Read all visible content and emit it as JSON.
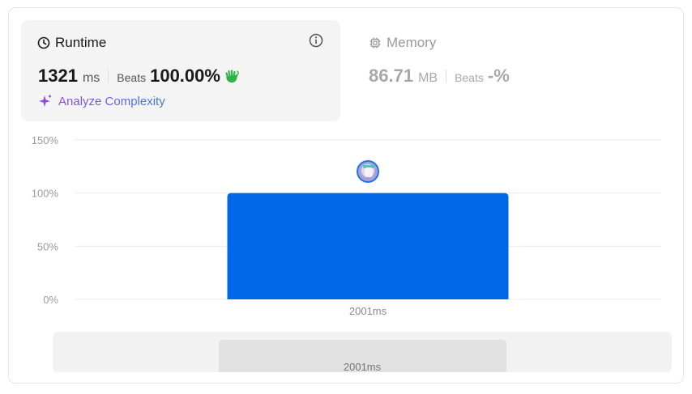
{
  "runtime": {
    "title": "Runtime",
    "value": "1321",
    "unit": "ms",
    "beats_label": "Beats",
    "beats_value": "100.00%",
    "analyze_label": "Analyze Complexity"
  },
  "memory": {
    "title": "Memory",
    "value": "86.71",
    "unit": "MB",
    "beats_label": "Beats",
    "beats_value": "-%"
  },
  "colors": {
    "bar": "#0067e6",
    "accent_purple": "#8a4fd8",
    "accent_blue": "#3f7ae0",
    "hand_green": "#2fb24a"
  },
  "chart_data": {
    "type": "bar",
    "categories": [
      "2001ms"
    ],
    "values": [
      100
    ],
    "ylim": [
      0,
      150
    ],
    "yticks": [
      "0%",
      "50%",
      "100%",
      "150%"
    ],
    "grid": true
  },
  "range_selector": {
    "label": "2001ms"
  }
}
